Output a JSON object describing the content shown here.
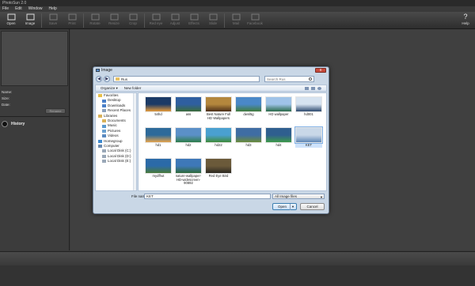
{
  "app": {
    "title": "PhotoSun 2.0"
  },
  "menu": [
    "File",
    "Edit",
    "Window",
    "Help"
  ],
  "toolbar": {
    "buttons": [
      {
        "label": "Open",
        "icon": "monitor-icon",
        "enabled": true
      },
      {
        "label": "Image",
        "icon": "image-icon",
        "enabled": true
      },
      {
        "label": "Save",
        "icon": "save-icon",
        "enabled": false
      },
      {
        "label": "Print",
        "icon": "print-icon",
        "enabled": false
      },
      {
        "label": "Rotate",
        "icon": "rotate-icon",
        "enabled": false
      },
      {
        "label": "Resize",
        "icon": "resize-icon",
        "enabled": false
      },
      {
        "label": "Crop",
        "icon": "crop-icon",
        "enabled": false
      },
      {
        "label": "Red eye",
        "icon": "eye-icon",
        "enabled": false
      },
      {
        "label": "Adjust",
        "icon": "adjust-icon",
        "enabled": false
      },
      {
        "label": "Effects",
        "icon": "star-icon",
        "enabled": false
      },
      {
        "label": "Slide",
        "icon": "slide-icon",
        "enabled": false
      },
      {
        "label": "Mail",
        "icon": "mail-icon",
        "enabled": false
      },
      {
        "label": "Facebook",
        "icon": "facebook-icon",
        "enabled": false
      }
    ],
    "help_label": "Help"
  },
  "left_panel": {
    "name_label": "Name:",
    "size_label": "Size:",
    "date_label": "Date:",
    "rename_label": "Rename",
    "history_label": "History"
  },
  "dialog": {
    "title": "Image",
    "close_label": "x",
    "path": "Rus",
    "search_placeholder": "Search Rus",
    "organize_label": "Organize ▾",
    "new_folder_label": "New folder",
    "nav_items": [
      {
        "label": "Favorites",
        "icon": "star-icon",
        "type": "header"
      },
      {
        "label": "Desktop",
        "icon": "desktop-icon",
        "type": "item"
      },
      {
        "label": "Downloads",
        "icon": "download-icon",
        "type": "item"
      },
      {
        "label": "Recent Places",
        "icon": "recent-icon",
        "type": "item"
      },
      {
        "label": "",
        "icon": "",
        "type": "gap"
      },
      {
        "label": "Libraries",
        "icon": "library-icon",
        "type": "header"
      },
      {
        "label": "Documents",
        "icon": "documents-icon",
        "type": "item"
      },
      {
        "label": "Music",
        "icon": "music-icon",
        "type": "item"
      },
      {
        "label": "Pictures",
        "icon": "pictures-icon",
        "type": "item"
      },
      {
        "label": "Videos",
        "icon": "videos-icon",
        "type": "item"
      },
      {
        "label": "",
        "icon": "",
        "type": "gap"
      },
      {
        "label": "Homegroup",
        "icon": "homegroup-icon",
        "type": "header"
      },
      {
        "label": "",
        "icon": "",
        "type": "gap"
      },
      {
        "label": "Computer",
        "icon": "computer-icon",
        "type": "header"
      },
      {
        "label": "Local Disk (C:)",
        "icon": "disk-icon",
        "type": "item"
      },
      {
        "label": "Local Disk (D:)",
        "icon": "disk-icon",
        "type": "item"
      },
      {
        "label": "Local Disk (E:)",
        "icon": "disk-icon",
        "type": "item"
      }
    ],
    "files": [
      {
        "label": "54hd",
        "c1": "#1b3a66",
        "c2": "#e59a3a",
        "selected": false
      },
      {
        "label": "ass",
        "c1": "#2f5fa0",
        "c2": "#3a6b3a",
        "selected": false
      },
      {
        "label": "Best Nature Full HD Wallpapers",
        "c1": "#b4873d",
        "c2": "#4a2d18",
        "selected": false
      },
      {
        "label": "dwnl5g",
        "c1": "#4a88c8",
        "c2": "#3f7b3a",
        "selected": false
      },
      {
        "label": "HD wallpaper",
        "c1": "#9fc3e8",
        "c2": "#2a6a4a",
        "selected": false
      },
      {
        "label": "hd001",
        "c1": "#d6e3f0",
        "c2": "#2c4a6e",
        "selected": false
      },
      {
        "label": "hd1",
        "c1": "#2d6a9a",
        "c2": "#e6a44c",
        "selected": false
      },
      {
        "label": "hd2",
        "c1": "#5b90c8",
        "c2": "#2e7d4a",
        "selected": false
      },
      {
        "label": "hd22",
        "c1": "#4aa0d0",
        "c2": "#3f8a3a",
        "selected": false
      },
      {
        "label": "hd3",
        "c1": "#3f6da3",
        "c2": "#6b8c3a",
        "selected": false
      },
      {
        "label": "hd4",
        "c1": "#2f5f8f",
        "c2": "#3f9a4a",
        "selected": false
      },
      {
        "label": "KET",
        "c1": "#c9d8e8",
        "c2": "#5f86b5",
        "selected": true
      },
      {
        "label": "mydfhut",
        "c1": "#2b6aa8",
        "c2": "#4a7a3a",
        "selected": false
      },
      {
        "label": "nature-wallpaper-HD-widescreen-90892",
        "c1": "#3e78b8",
        "c2": "#2f6a3a",
        "selected": false
      },
      {
        "label": "Red Eye Bird",
        "c1": "#6b5a3a",
        "c2": "#2d2a22",
        "selected": false
      }
    ],
    "file_name_label": "File name:",
    "file_name_value": "KET",
    "file_type_value": "All Image files",
    "open_label": "Open",
    "cancel_label": "Cancel"
  }
}
